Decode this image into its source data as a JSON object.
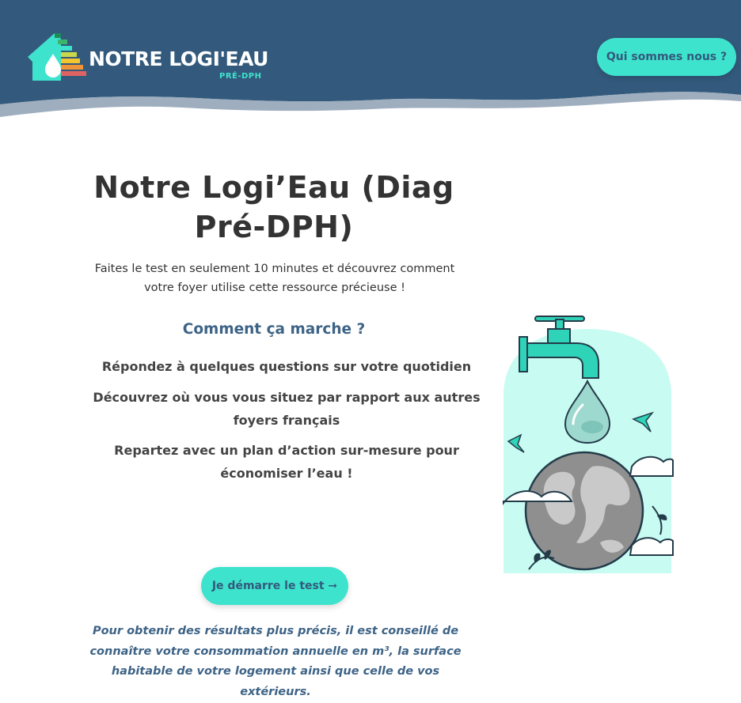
{
  "header": {
    "logo_text": "NOTRE LOGI'EAU",
    "logo_sub": "PRÉ-DPH",
    "logo_grades": [
      "A",
      "B",
      "C",
      "D",
      "E",
      "F",
      "G"
    ],
    "nav_button": "Qui sommes nous ?"
  },
  "main": {
    "title": "Notre Logi’Eau (Diag Pré-DPH)",
    "intro": "Faites le test en seulement 10 minutes et découvrez comment votre foyer utilise cette ressource précieuse !",
    "how_heading": "Comment ça marche ?",
    "steps": [
      "Répondez à quelques questions sur votre quotidien",
      "Découvrez où vous vous situez par rapport aux autres foyers français",
      "Repartez avec un plan d’action sur-mesure pour économiser l’eau !"
    ],
    "cta_label": "Je démarre le test ➞",
    "note": "Pour obtenir des résultats plus précis, il est conseillé de connaître votre consommation annuelle en m³, la surface habitable de votre logement ainsi que celle de vos extérieurs."
  },
  "colors": {
    "header_bg": "#335a7c",
    "accent": "#3ee3cd",
    "heading_blue": "#3d6386",
    "text": "#333333"
  },
  "illustration": {
    "icon": "water-tap-earth-illustration"
  }
}
